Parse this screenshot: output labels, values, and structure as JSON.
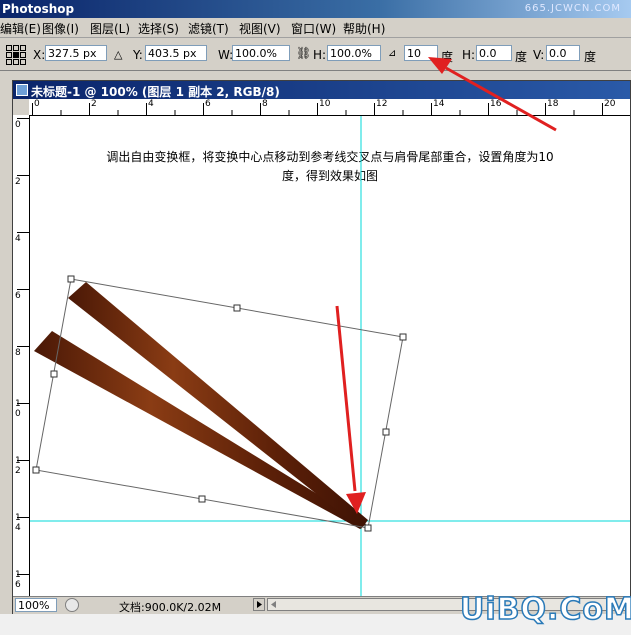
{
  "app": {
    "title": "Photoshop",
    "watermark": "665.JCWCN.COM"
  },
  "menu": [
    {
      "label": "编辑(E)"
    },
    {
      "label": "图像(I)"
    },
    {
      "label": "图层(L)"
    },
    {
      "label": "选择(S)"
    },
    {
      "label": "滤镜(T)"
    },
    {
      "label": "视图(V)"
    },
    {
      "label": "窗口(W)"
    },
    {
      "label": "帮助(H)"
    }
  ],
  "options": {
    "x_label": "X:",
    "x_value": "327.5 px",
    "y_label": "Y:",
    "y_value": "403.5 px",
    "w_label": "W:",
    "w_value": "100.0%",
    "h_label": "H:",
    "h_value": "100.0%",
    "angle_value": "10",
    "angle_unit": "度",
    "hskew_label": "H:",
    "hskew_value": "0.0",
    "hskew_unit": "度",
    "vskew_label": "V:",
    "vskew_value": "0.0",
    "vskew_unit": "度"
  },
  "document": {
    "title": "未标题-1 @ 100% (图层 1 副本 2, RGB/8)",
    "h_ruler": [
      "0",
      "2",
      "4",
      "6",
      "8",
      "10",
      "12",
      "14",
      "16",
      "18",
      "20"
    ],
    "v_ruler": [
      "0",
      "2",
      "4",
      "6",
      "8",
      "1\n0",
      "1\n2",
      "1\n4",
      "1\n6"
    ],
    "caption_line1": "调出自由变换框，将变换中心点移动到参考线交叉点与肩骨尾部重合，设置角度为10",
    "caption_line2": "度，得到效果如图",
    "zoom": "100%",
    "doc_size": "文档:900.0K/2.02M"
  },
  "colors": {
    "guide": "#00d8d8",
    "arrow": "#e02020",
    "wood": "#6a2a0c"
  },
  "logo": "UiBQ.CoM"
}
